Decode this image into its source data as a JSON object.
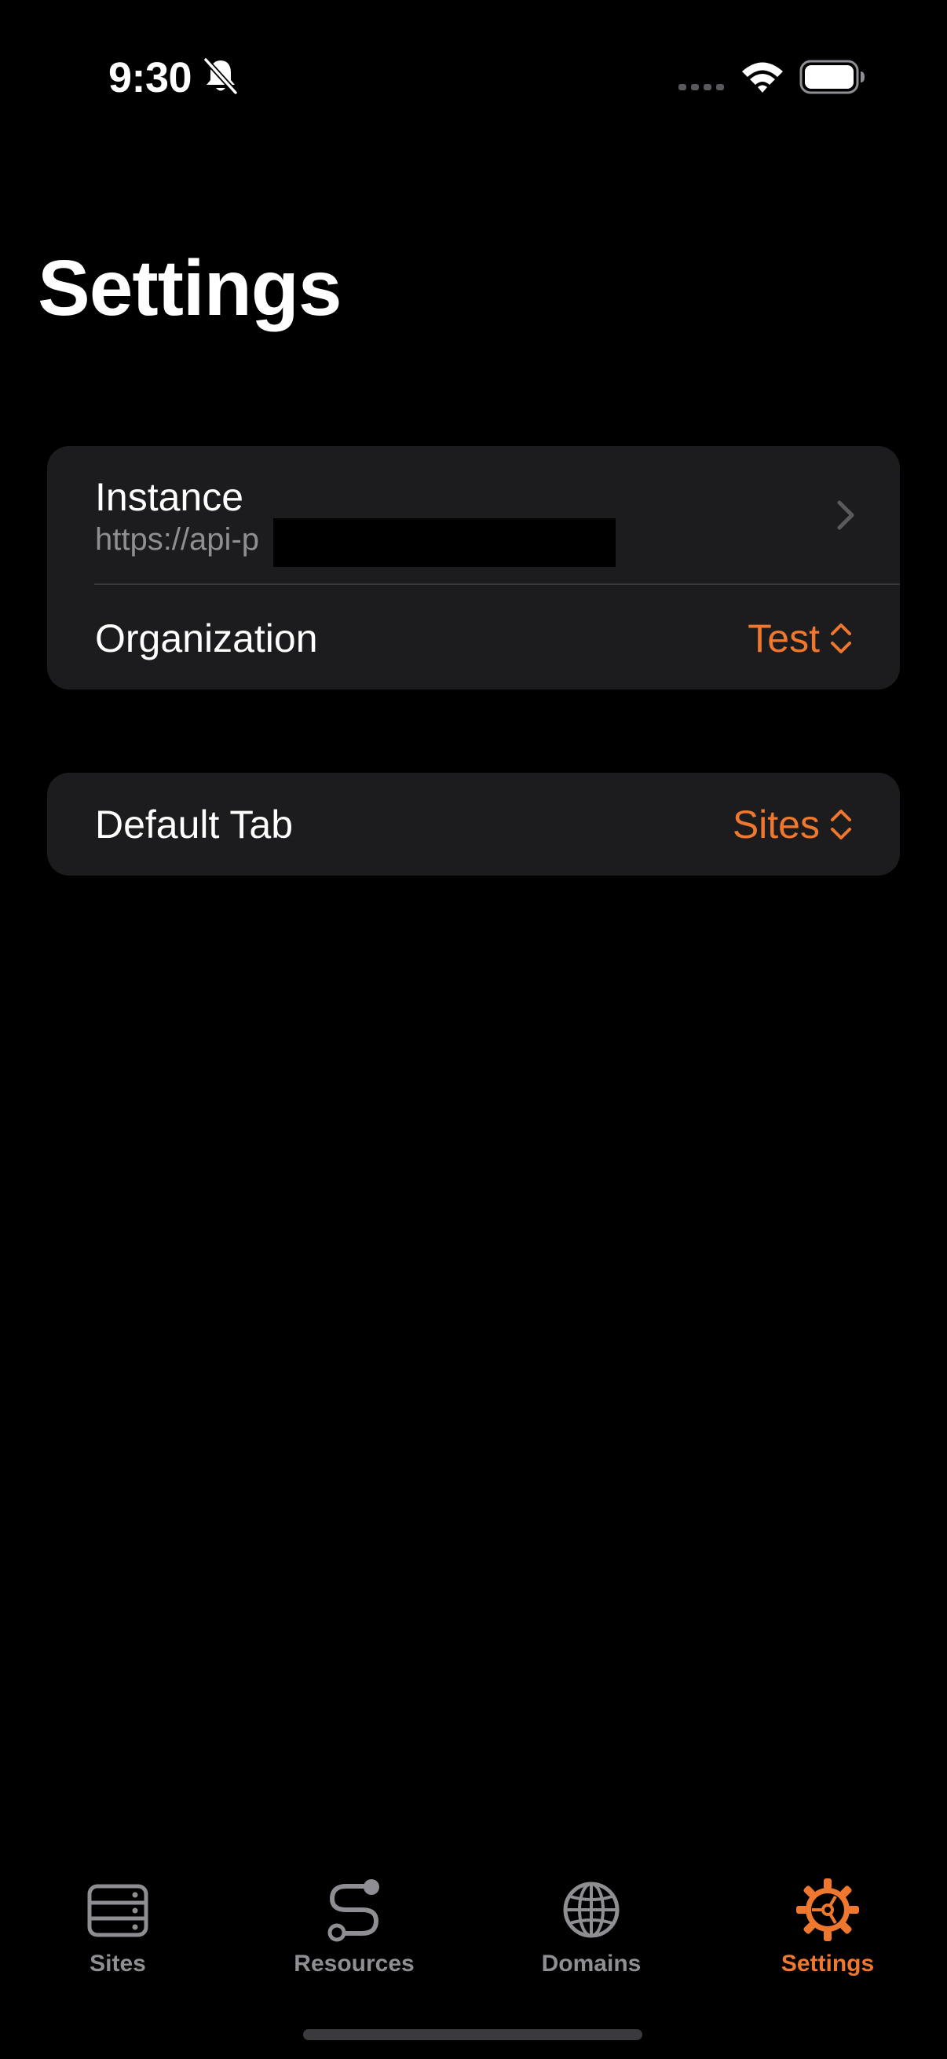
{
  "status_bar": {
    "time": "9:30",
    "icons": [
      "bell-slash-icon",
      "cellular-icon",
      "wifi-icon",
      "battery-icon"
    ]
  },
  "title": "Settings",
  "groups": {
    "connection": {
      "instance": {
        "label": "Instance",
        "value": "https://api-p"
      },
      "organization": {
        "label": "Organization",
        "value": "Test"
      }
    },
    "preferences": {
      "default_tab": {
        "label": "Default Tab",
        "value": "Sites"
      }
    }
  },
  "tab_bar": {
    "items": [
      {
        "label": "Sites",
        "icon": "server-rack-icon",
        "active": false
      },
      {
        "label": "Resources",
        "icon": "route-icon",
        "active": false
      },
      {
        "label": "Domains",
        "icon": "globe-icon",
        "active": false
      },
      {
        "label": "Settings",
        "icon": "gear-icon",
        "active": true
      }
    ]
  },
  "colors": {
    "accent": "#f0772e",
    "background": "#000000",
    "group_background": "#1c1c1e",
    "secondary_text": "#8e8e93"
  }
}
